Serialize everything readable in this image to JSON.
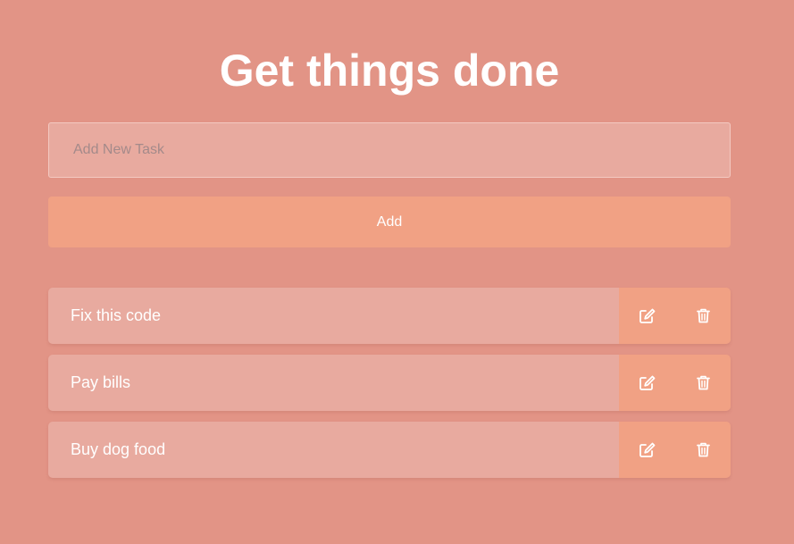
{
  "app": {
    "title": "Get things done"
  },
  "new_task": {
    "placeholder": "Add New Task",
    "value": "",
    "add_label": "Add"
  },
  "tasks": [
    {
      "text": "Fix this code",
      "edit_icon": "edit-icon",
      "delete_icon": "trash-icon"
    },
    {
      "text": "Pay bills",
      "edit_icon": "edit-icon",
      "delete_icon": "trash-icon"
    },
    {
      "text": "Buy dog food",
      "edit_icon": "edit-icon",
      "delete_icon": "trash-icon"
    }
  ],
  "colors": {
    "background": "#e29486",
    "input_background": "#e8aa9f",
    "accent": "#f1a184",
    "text": "#ffffff"
  }
}
